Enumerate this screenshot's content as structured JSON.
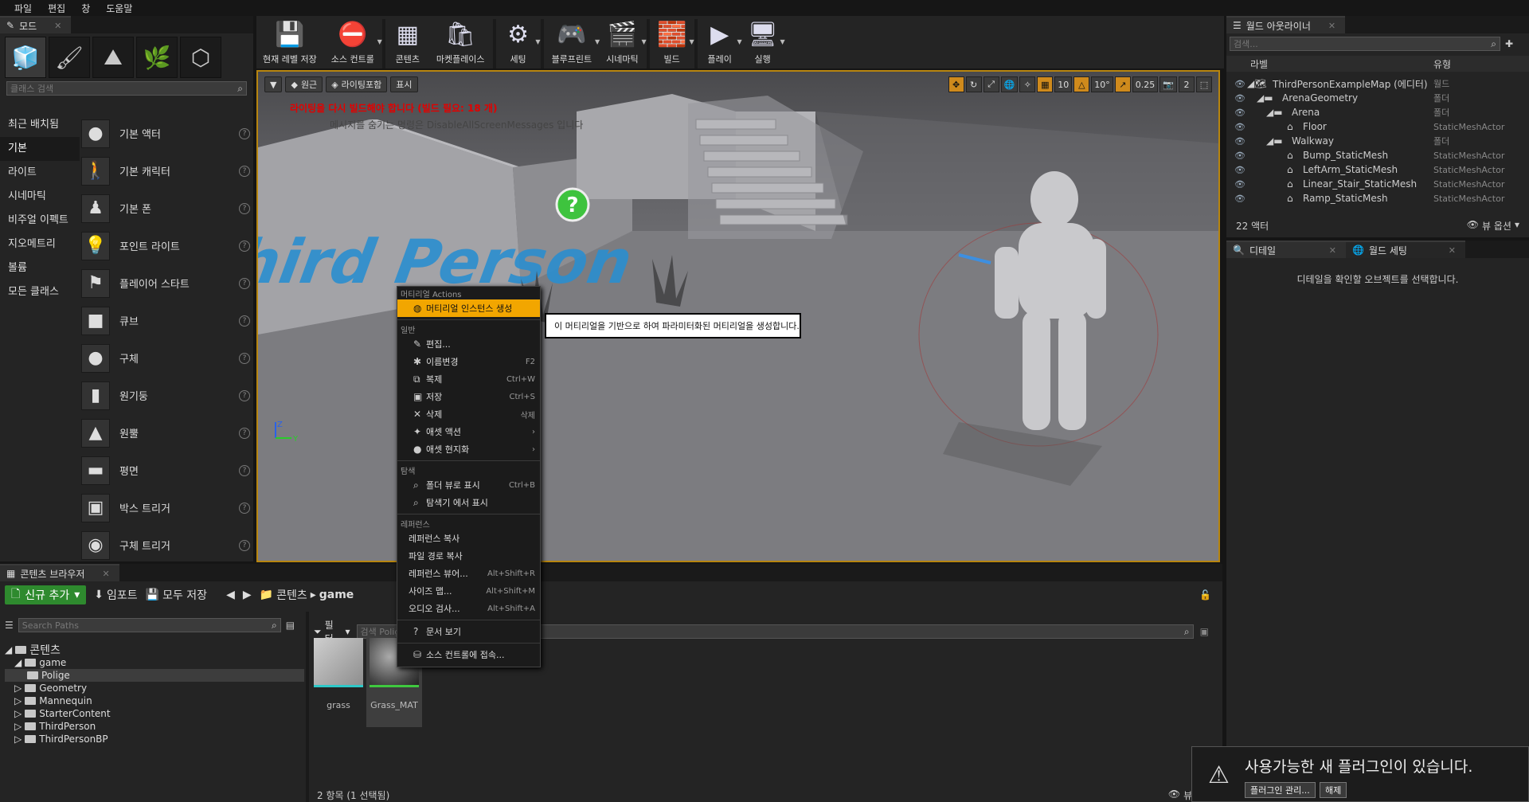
{
  "menubar": [
    "파일",
    "편집",
    "창",
    "도움말"
  ],
  "modes": {
    "tab_label": "모드",
    "search_placeholder": "클래스 검색",
    "categories": [
      "최근 배치됨",
      "기본",
      "라이트",
      "시네마틱",
      "비주얼 이펙트",
      "지오메트리",
      "볼륨",
      "모든 클래스"
    ],
    "selected_category": "기본",
    "items": [
      "기본 액터",
      "기본 캐릭터",
      "기본 폰",
      "포인트 라이트",
      "플레이어 스타트",
      "큐브",
      "구체",
      "원기둥",
      "원뿔",
      "평면",
      "박스 트리거",
      "구체 트리거"
    ],
    "help_glyph": "?"
  },
  "toolbar": {
    "buttons": [
      "현재 레벨 저장",
      "소스 컨트롤",
      "콘텐츠",
      "마켓플레이스",
      "세팅",
      "블루프린트",
      "시네마틱",
      "빌드",
      "플레이",
      "실행"
    ]
  },
  "viewport": {
    "perspective": "원근",
    "lit": "라이팅포함",
    "show": "표시",
    "warning": "라이팅을 다시 빌드해야 합니다 (빌드 필요: 18 개)",
    "hint": "메시지를 숨기는 명령은 DisableAllScreenMessages 입니다",
    "grid_snap": "10",
    "rot_snap": "10°",
    "scale_snap": "0.25",
    "cam_speed": "2",
    "floor_text": "Third Person",
    "axis_z": "Z",
    "axis_y": "Y"
  },
  "outliner": {
    "tab_label": "월드 아웃라이너",
    "search_placeholder": "검색...",
    "col_label": "라벨",
    "col_type": "유형",
    "rows": [
      {
        "name": "ThirdPersonExampleMap (에디터)",
        "type": "월드"
      },
      {
        "name": "ArenaGeometry",
        "type": "폴더"
      },
      {
        "name": "Arena",
        "type": "폴더"
      },
      {
        "name": "Floor",
        "type": "StaticMeshActor"
      },
      {
        "name": "Walkway",
        "type": "폴더"
      },
      {
        "name": "Bump_StaticMesh",
        "type": "StaticMeshActor"
      },
      {
        "name": "LeftArm_StaticMesh",
        "type": "StaticMeshActor"
      },
      {
        "name": "Linear_Stair_StaticMesh",
        "type": "StaticMeshActor"
      },
      {
        "name": "Ramp_StaticMesh",
        "type": "StaticMeshActor"
      }
    ],
    "actor_count": "22 액터",
    "view_options": "뷰 옵션"
  },
  "details": {
    "tab_details": "디테일",
    "tab_world": "월드 세팅",
    "empty_msg": "디테일을 확인할 오브젝트를 선택합니다."
  },
  "content_browser": {
    "tab_label": "콘텐츠 브라우저",
    "add_new": "신규 추가",
    "import": "임포트",
    "save_all": "모두 저장",
    "path_root": "콘텐츠",
    "path_current": "game",
    "search_paths_placeholder": "Search Paths",
    "filter": "필터",
    "search_assets_placeholder": "검색 Polige",
    "tree": [
      {
        "label": "콘텐츠",
        "depth": 0
      },
      {
        "label": "game",
        "depth": 1
      },
      {
        "label": "Polige",
        "depth": 2
      },
      {
        "label": "Geometry",
        "depth": 1
      },
      {
        "label": "Mannequin",
        "depth": 1
      },
      {
        "label": "StarterContent",
        "depth": 1
      },
      {
        "label": "ThirdPerson",
        "depth": 1
      },
      {
        "label": "ThirdPersonBP",
        "depth": 1
      }
    ],
    "assets": [
      "grass",
      "Grass_MAT"
    ],
    "status": "2 항목 (1 선택됨)",
    "view_options": "뷰 옵션"
  },
  "context_menu": {
    "sec_material": "머티리얼 Actions",
    "create_instance": "머티리얼 인스턴스 생성",
    "sec_common": "일반",
    "common": [
      {
        "label": "편집...",
        "shortcut": "",
        "icon": "✎"
      },
      {
        "label": "이름변경",
        "shortcut": "F2",
        "icon": "✱"
      },
      {
        "label": "복제",
        "shortcut": "Ctrl+W",
        "icon": "⧉"
      },
      {
        "label": "저장",
        "shortcut": "Ctrl+S",
        "icon": "▣"
      },
      {
        "label": "삭제",
        "shortcut": "삭제",
        "icon": "✕"
      },
      {
        "label": "애셋 액션",
        "shortcut": "›",
        "icon": "✦"
      },
      {
        "label": "애셋 현지화",
        "shortcut": "›",
        "icon": "●"
      }
    ],
    "sec_explore": "탐색",
    "explore": [
      {
        "label": "폴더 뷰로 표시",
        "shortcut": "Ctrl+B",
        "icon": "⌕"
      },
      {
        "label": "탐색기 에서 표시",
        "shortcut": "",
        "icon": "⌕"
      }
    ],
    "sec_ref": "레퍼런스",
    "refs": [
      {
        "label": "레퍼런스 복사",
        "shortcut": ""
      },
      {
        "label": "파일 경로 복사",
        "shortcut": ""
      },
      {
        "label": "레퍼런스 뷰어...",
        "shortcut": "Alt+Shift+R"
      },
      {
        "label": "사이즈 맵...",
        "shortcut": "Alt+Shift+M"
      },
      {
        "label": "오디오 검사...",
        "shortcut": "Alt+Shift+A"
      }
    ],
    "docs": "문서 보기",
    "source_control": "소스 컨트롤에 접속..."
  },
  "tooltip": "이 머티리얼을 기반으로 하여 파라미터화된 머티리얼을 생성합니다.",
  "notification": {
    "message": "사용가능한 새 플러그인이 있습니다.",
    "manage": "플러그인 관리...",
    "dismiss": "해제"
  }
}
